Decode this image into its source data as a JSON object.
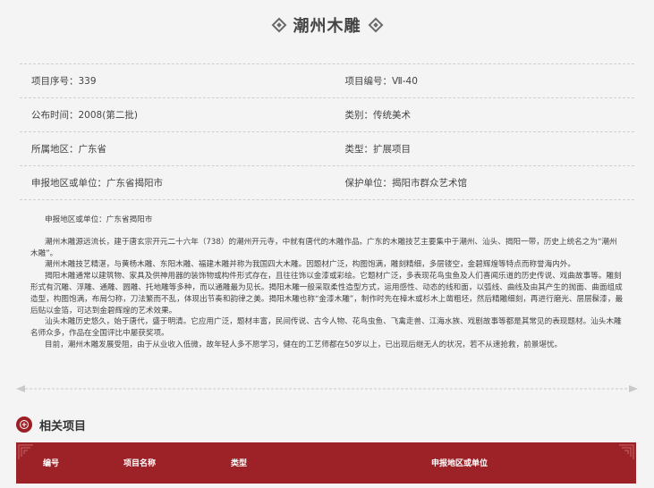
{
  "page": {
    "title": "潮州木雕"
  },
  "info": {
    "rows": [
      [
        "项目序号：339",
        "项目编号：Ⅶ-40"
      ],
      [
        "公布时间：2008(第二批)",
        "类别：传统美术"
      ],
      [
        "所属地区：广东省",
        "类型：扩展项目"
      ],
      [
        "申报地区或单位：广东省揭阳市",
        "保护单位：揭阳市群众艺术馆"
      ]
    ]
  },
  "description": {
    "header": "申报地区或单位：广东省揭阳市",
    "paragraphs": [
      "潮州木雕源远流长，建于唐玄宗开元二十六年（738）的潮州开元寺，中就有唐代的木雕作品。广东的木雕技艺主要集中于潮州、汕头、揭阳一带，历史上统名之为“潮州木雕”。",
      "潮州木雕技艺精湛，与黄杨木雕、东阳木雕、福建木雕并称为我国四大木雕。因题材广泛，构图饱满，雕刻精细，多层镂空，金碧辉煌等特点而称誉海内外。",
      "揭阳木雕通常以建筑物、家具及供神用器的装饰物或构件形式存在，且往往饰以金漆或彩绘。它题材广泛，多表现花鸟虫鱼及人们喜闻乐道的历史传说、戏曲故事等。雕刻形式有沉雕、浮雕、通雕、圆雕、托地雕等多种，而以通雕最为见长。揭阳木雕一般采取柔性造型方式，运用感性、动态的线和面，以弧线、曲线及由其产生的抛面、曲面组成造型，构图饱满，布局匀称，刀法繁而不乱，体现出节奏和韵律之美。揭阳木雕也称“金漆木雕”，制作时先在樟木或杉木上凿粗坯，然后精雕细刻，再进行磨光、层层髹漆，最后贴以金箔，可达到金碧辉煌的艺术效果。",
      "汕头木雕历史悠久，始于唐代，盛于明清。它应用广泛，题材丰富，民间传说、古今人物、花鸟虫鱼、飞禽走兽、江海水族、戏剧故事等都是其常见的表现题材。汕头木雕名师众多，作品在全国评比中屡获奖项。",
      "目前，潮州木雕发展受阻，由于从业收入低微，故年轻人多不愿学习，健在的工艺师都在50岁以上，已出现后继无人的状况，若不从速抢救，前景堪忧。"
    ]
  },
  "related": {
    "heading": "相关项目",
    "columns": [
      "编号",
      "项目名称",
      "类型",
      "申报地区或单位"
    ]
  },
  "colors": {
    "accent_red": "#9d2228",
    "background": "#f4f4f4"
  },
  "icons": [
    "diamond-ornament-icon",
    "seal-icon",
    "corner-pattern-icon"
  ]
}
